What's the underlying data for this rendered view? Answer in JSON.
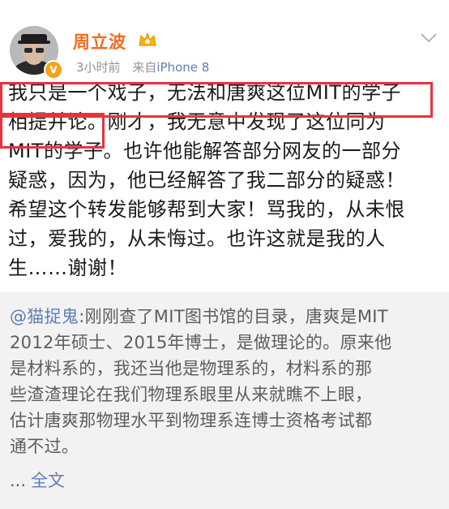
{
  "header": {
    "username": "周立波",
    "time": "3小时前",
    "source_label": "来自",
    "device": "iPhone 8"
  },
  "post": {
    "lines": [
      "我只是一个戏子，无法和唐爽这位MIT的学子",
      "相提并论。刚才，我无意中发现了这位同为",
      "MIT的学子。也许他能解答部分网友的一部分",
      "疑惑，因为，他已经解答了我二部分的疑惑！",
      "希望这个转发能够帮到大家！骂我的，从未恨",
      "过，爱我的，从未悔过。也许这就是我的人",
      "生……谢谢！"
    ]
  },
  "repost": {
    "mention": "@猫捉鬼",
    "lines": [
      ":刚刚查了MIT图书馆的目录，唐爽是MIT",
      "2012年硕士、2015年博士，是做理论的。原来他",
      "是材料系的，我还当他是物理系的，材料系的那",
      "些渣渣理论在我们物理系眼里从来就瞧不上眼，",
      "估计唐爽那物理水平到物理系连博士资格考试都",
      "通不过。"
    ],
    "ellipsis": "...",
    "full_text_link": "全文"
  },
  "colors": {
    "username": "#f26a21",
    "link": "#5a7fb5",
    "highlight_box": "#e5343f",
    "meta": "#939393",
    "repost_bg": "#f2f2f2"
  },
  "icons": [
    "avatar",
    "verified-badge-icon",
    "crown-badge-icon",
    "chevron-down-icon"
  ]
}
